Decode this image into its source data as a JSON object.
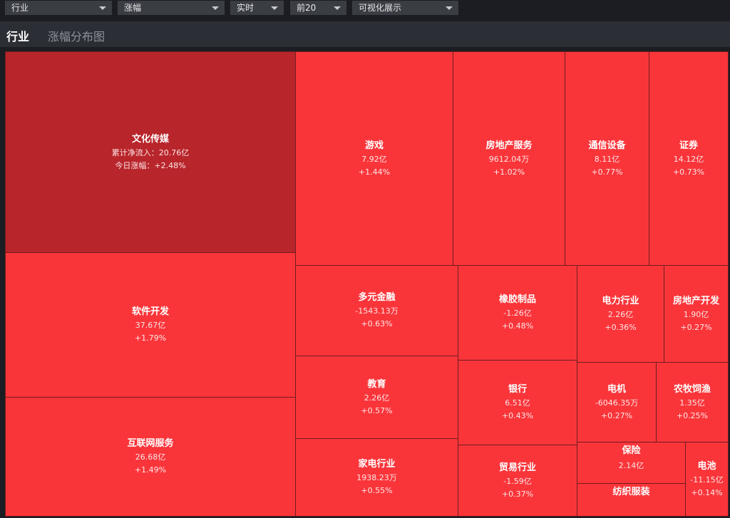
{
  "filters": {
    "industry": "行业",
    "metric": "涨幅",
    "period": "实时",
    "top": "前20",
    "view": "可视化展示"
  },
  "header": {
    "title": "行业",
    "subtitle": "涨幅分布图"
  },
  "tiles": [
    {
      "name": "文化传媒",
      "inflow": "累计净流入：20.76亿",
      "change": "今日涨幅：+2.48%"
    },
    {
      "name": "软件开发",
      "inflow": "37.67亿",
      "change": "+1.79%"
    },
    {
      "name": "互联网服务",
      "inflow": "26.68亿",
      "change": "+1.49%"
    },
    {
      "name": "游戏",
      "inflow": "7.92亿",
      "change": "+1.44%"
    },
    {
      "name": "房地产服务",
      "inflow": "9612.04万",
      "change": "+1.02%"
    },
    {
      "name": "通信设备",
      "inflow": "8.11亿",
      "change": "+0.77%"
    },
    {
      "name": "证券",
      "inflow": "14.12亿",
      "change": "+0.73%"
    },
    {
      "name": "多元金融",
      "inflow": "-1543.13万",
      "change": "+0.63%"
    },
    {
      "name": "教育",
      "inflow": "2.26亿",
      "change": "+0.57%"
    },
    {
      "name": "家电行业",
      "inflow": "1938.23万",
      "change": "+0.55%"
    },
    {
      "name": "橡胶制品",
      "inflow": "-1.26亿",
      "change": "+0.48%"
    },
    {
      "name": "银行",
      "inflow": "6.51亿",
      "change": "+0.43%"
    },
    {
      "name": "贸易行业",
      "inflow": "-1.59亿",
      "change": "+0.37%"
    },
    {
      "name": "电力行业",
      "inflow": "2.26亿",
      "change": "+0.36%"
    },
    {
      "name": "房地产开发",
      "inflow": "1.90亿",
      "change": "+0.27%"
    },
    {
      "name": "电机",
      "inflow": "-6046.35万",
      "change": "+0.27%"
    },
    {
      "name": "农牧饲渔",
      "inflow": "1.35亿",
      "change": "+0.25%"
    },
    {
      "name": "保险",
      "inflow": "2.14亿",
      "change": ""
    },
    {
      "name": "纺织服装",
      "inflow": "",
      "change": ""
    },
    {
      "name": "电池",
      "inflow": "-11.15亿",
      "change": "+0.14%"
    }
  ]
}
